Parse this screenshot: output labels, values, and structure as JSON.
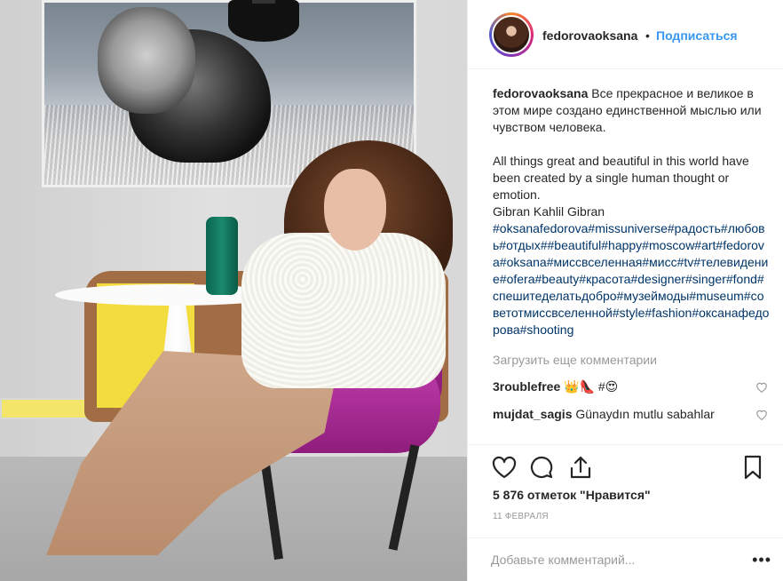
{
  "post": {
    "username": "fedorovaoksana",
    "dot": "•",
    "follow_label": "Подписаться",
    "caption_ru": "Все прекрасное и великое в этом мире создано единственной мыслью или чувством человека.",
    "caption_en": "All things great and beautiful in this world have been created by a single human thought or emotion.\nGibran Kahlil Gibran",
    "hashtags": "#oksanafedorova#missuniverse#радость#любовь#отдых##beautiful#happy#moscow#art#fedorova#oksana#миссвселенная#мисс#tv#телевидение#ofera#beauty#красота#designer#singer#fond#спешитеделатьдобро#музеймоды#museum#советотмиссвселенной#style#fashion#оксанафедорова#shooting",
    "load_more": "Загрузить еще комментарии",
    "comments": [
      {
        "user": "3roublefree",
        "text": "👑👠 #😍"
      },
      {
        "user": "mujdat_sagis",
        "text": "Günaydın mutlu sabahlar"
      }
    ],
    "likes": "5 876 отметок \"Нравится\"",
    "date": "11 февраля",
    "comment_placeholder": "Добавьте комментарий...",
    "more_options": "•••"
  },
  "icons": {
    "like": "heart-icon",
    "comment": "comment-icon",
    "share": "share-icon",
    "save": "bookmark-icon"
  },
  "colors": {
    "link": "#3897f0",
    "hashtag": "#003569",
    "muted": "#999999",
    "text": "#262626",
    "chair": "#b0309a"
  }
}
